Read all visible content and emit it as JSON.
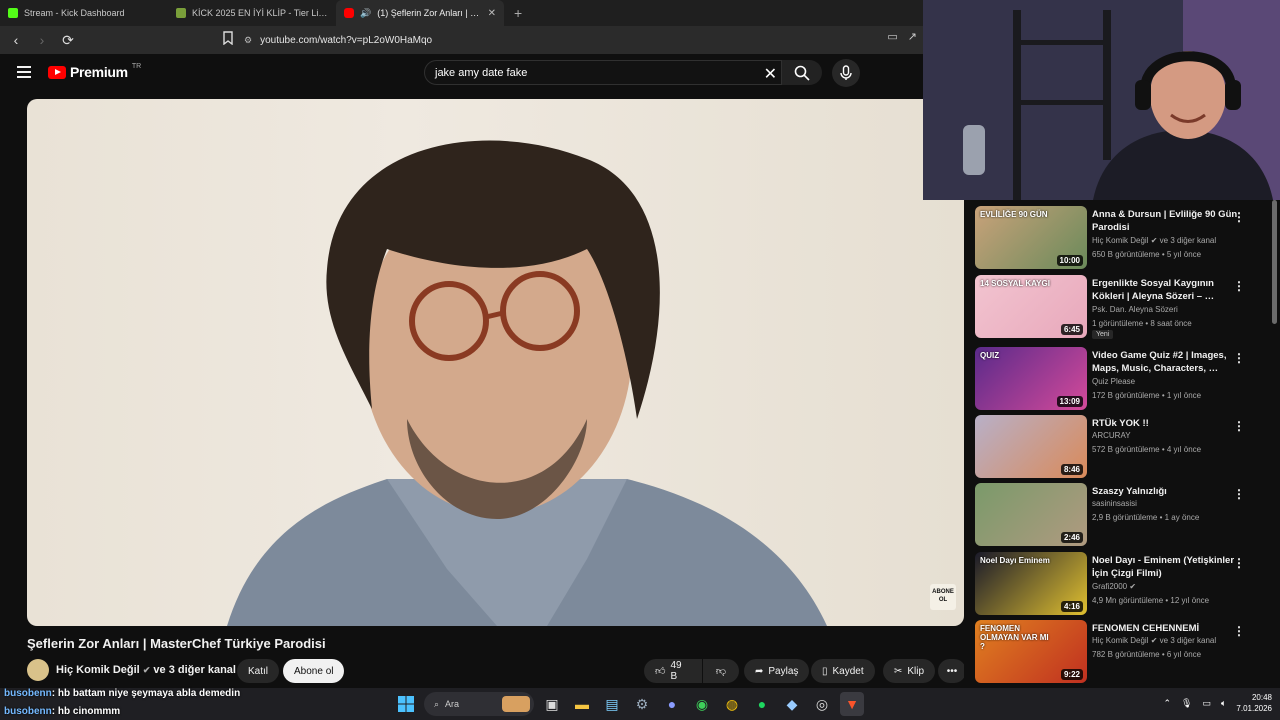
{
  "browser": {
    "tabs": [
      {
        "title": "Stream - Kick Dashboard",
        "fav_color": "#53fc18",
        "active": false
      },
      {
        "title": "KİCK 2025 EN İYİ KLİP - Tier List | Kör",
        "fav_color": "#7a9f3a",
        "active": false
      },
      {
        "title": "(1) Şeflerin Zor Anları | Master",
        "fav_color": "#ff0000",
        "active": true
      }
    ],
    "url": "youtube.com/watch?v=pL2oW0HaMqo"
  },
  "youtube": {
    "logo_word": "Premium",
    "country": "TR",
    "search_value": "jake amy date fake"
  },
  "video": {
    "title": "Şeflerin Zor Anları | MasterChef Türkiye Parodisi",
    "overlay_badge": "ABONE OL",
    "channel": "Hiç Komik Değil",
    "channel_suffix": "ve 3 diğer kanal",
    "join_label": "Katıl",
    "subscribe_label": "Abone ol",
    "likes": "49 B",
    "share_label": "Paylaş",
    "save_label": "Kaydet",
    "clip_label": "Klip",
    "more_label": "•••"
  },
  "recommendations": [
    {
      "title": "Anna & Dursun | Evliliğe 90 Gün Parodisi",
      "channel": "Hiç Komik Değil",
      "verified": true,
      "channel_suffix": "ve 3 diğer kanal",
      "meta": "650 B görüntüleme • 5 yıl önce",
      "duration": "10:00",
      "colors": [
        "#c9a27a",
        "#6a8a5a"
      ],
      "badge": "",
      "thumb_text": "EVLİLİĞE 90 GÜN"
    },
    {
      "title": "Ergenlikte Sosyal Kaygının Kökleri | Aleyna Sözeri – …",
      "channel": "Psk. Dan. Aleyna Sözeri",
      "verified": false,
      "channel_suffix": "",
      "meta": "1 görüntüleme • 8 saat önce",
      "duration": "6:45",
      "colors": [
        "#f2c4d0",
        "#e8a8bb"
      ],
      "badge": "Yeni",
      "thumb_text": "14 SOSYAL KAYGI"
    },
    {
      "title": "Video Game Quiz #2 | Images, Maps, Music, Characters, …",
      "channel": "Quiz Please",
      "verified": false,
      "channel_suffix": "",
      "meta": "172 B görüntüleme • 1 yıl önce",
      "duration": "13:09",
      "colors": [
        "#5a2a8a",
        "#d44a9a"
      ],
      "badge": "",
      "thumb_text": "QUIZ"
    },
    {
      "title": "RTÜk YOK !!",
      "channel": "ARCURAY",
      "verified": false,
      "channel_suffix": "",
      "meta": "572 B görüntüleme • 4 yıl önce",
      "duration": "8:46",
      "colors": [
        "#b8b0c8",
        "#d98a5a"
      ],
      "badge": "",
      "thumb_text": ""
    },
    {
      "title": "Szaszy Yalnızlığı",
      "channel": "sasininsasisi",
      "verified": false,
      "channel_suffix": "",
      "meta": "2,9 B görüntüleme • 1 ay önce",
      "duration": "2:46",
      "colors": [
        "#7a9a6a",
        "#b09a80"
      ],
      "badge": "",
      "thumb_text": ""
    },
    {
      "title": "Noel Dayı - Eminem (Yetişkinler İçin Çizgi Filmi)",
      "channel": "Grafi2000",
      "verified": true,
      "channel_suffix": "",
      "meta": "4,9 Mn görüntüleme • 12 yıl önce",
      "duration": "4:16",
      "colors": [
        "#1a1a2a",
        "#e0c030"
      ],
      "badge": "",
      "thumb_text": "Noel Dayı Eminem"
    },
    {
      "title": "FENOMEN CEHENNEMİ",
      "channel": "Hiç Komik Değil",
      "verified": true,
      "channel_suffix": "ve 3 diğer kanal",
      "meta": "782 B görüntüleme • 6 yıl önce",
      "duration": "9:22",
      "colors": [
        "#e08020",
        "#c03020"
      ],
      "badge": "",
      "thumb_text": "FENOMEN OLMAYAN VAR MI ?"
    }
  ],
  "chat": [
    {
      "user": "busobenn",
      "text": ": hb battam niye şeymaya abla demedin"
    },
    {
      "user": "busobenn",
      "text": ": hb cinommm"
    }
  ],
  "taskbar": {
    "search_label": "Ara",
    "weather": "19°C",
    "time": "20:48",
    "date": "7.01.2026"
  }
}
